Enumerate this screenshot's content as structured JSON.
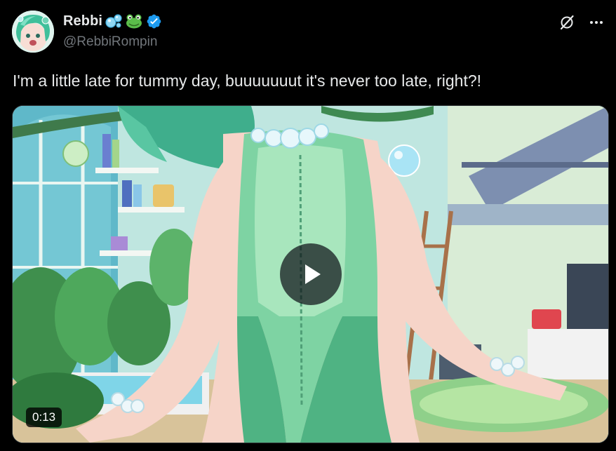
{
  "author": {
    "display_name": "Rebbi",
    "emoji_bubbles": "🫧",
    "emoji_frog": "🐸",
    "handle": "@RebbiRompin",
    "verified": true
  },
  "post": {
    "text": "I'm a little late for tummy day, buuuuuuut it's never too late, right?!"
  },
  "media": {
    "type": "video",
    "duration": "0:13"
  },
  "icons": {
    "verified": "verified-badge-icon",
    "grok": "grok-icon",
    "more": "more-options-icon",
    "play": "play-icon"
  },
  "colors": {
    "background": "#000000",
    "text_primary": "#e7e9ea",
    "text_secondary": "#71767b",
    "verified_blue": "#1d9bf0"
  }
}
